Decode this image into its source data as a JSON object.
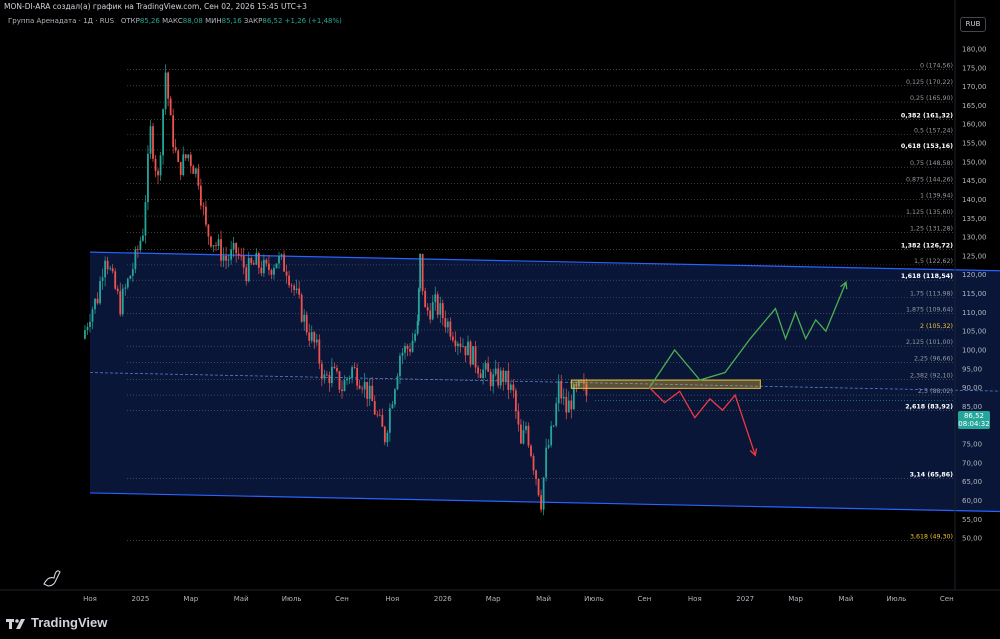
{
  "header": {
    "caption": "MON-DI-ARA создал(а) график на TradingView.com, Сен 02, 2026 15:45 UTC+3"
  },
  "legend": {
    "symbol": "Группа Аренадата · 1Д · RUS",
    "open_label": "ОТКР",
    "open_value": "85,26",
    "high_label": "МАКС",
    "high_value": "88,08",
    "low_label": "МИН",
    "low_value": "85,16",
    "close_label": "ЗАКР",
    "close_value": "86,52",
    "change": "+1,26 (+1,48%)"
  },
  "currency_button": "RUB",
  "price_tag": {
    "price": "86,52",
    "countdown": "08:04:32",
    "color": "#26a69a"
  },
  "branding": {
    "logo_text": "TradingView"
  },
  "colors": {
    "up": "#26a69a",
    "down": "#ef5350",
    "channel": "#2962ff",
    "fib_gold": "#f0c43a",
    "green_path": "#4caf50",
    "red_path": "#f23645",
    "zone": "#f0c43a"
  },
  "chart_data": {
    "type": "candlestick",
    "y_axis": {
      "min": 45,
      "max": 180,
      "ticks": [
        "180,00",
        "175,00",
        "170,00",
        "165,00",
        "160,00",
        "155,00",
        "150,00",
        "145,00",
        "140,00",
        "135,00",
        "130,00",
        "125,00",
        "120,00",
        "115,00",
        "110,00",
        "105,00",
        "100,00",
        "95,00",
        "90,00",
        "85,00",
        "80,00",
        "75,00",
        "70,00",
        "65,00",
        "60,00",
        "55,00",
        "50,00"
      ],
      "tick_values": [
        180,
        175,
        170,
        165,
        160,
        155,
        150,
        145,
        140,
        135,
        130,
        125,
        120,
        115,
        110,
        105,
        100,
        95,
        90,
        85,
        80,
        75,
        70,
        65,
        60,
        55,
        50
      ]
    },
    "x_axis": {
      "labels": [
        "Ноя",
        "2025",
        "Мар",
        "Май",
        "Июль",
        "Сен",
        "Ноя",
        "2026",
        "Мар",
        "Май",
        "Июль",
        "Сен",
        "Ноя",
        "2027",
        "Мар",
        "Май",
        "Июль",
        "Сен"
      ],
      "label_months": [
        0,
        2,
        4,
        6,
        8,
        10,
        12,
        14,
        16,
        18,
        20,
        22,
        24,
        26,
        28,
        30,
        32,
        34
      ]
    },
    "fib_levels": [
      {
        "label": "0 (174,56)",
        "value": 174.56,
        "bold": false,
        "gold": false
      },
      {
        "label": "0,125 (170,22)",
        "value": 170.22,
        "bold": false,
        "gold": false
      },
      {
        "label": "0,25 (165,90)",
        "value": 165.9,
        "bold": false,
        "gold": false
      },
      {
        "label": "0,382 (161,32)",
        "value": 161.32,
        "bold": true,
        "gold": false
      },
      {
        "label": "0,5 (157,24)",
        "value": 157.24,
        "bold": false,
        "gold": false
      },
      {
        "label": "0,618 (153,16)",
        "value": 153.16,
        "bold": true,
        "gold": false
      },
      {
        "label": "0,75 (148,58)",
        "value": 148.58,
        "bold": false,
        "gold": false
      },
      {
        "label": "0,875 (144,26)",
        "value": 144.26,
        "bold": false,
        "gold": false
      },
      {
        "label": "1 (139,94)",
        "value": 139.94,
        "bold": false,
        "gold": false
      },
      {
        "label": "1,125 (135,60)",
        "value": 135.6,
        "bold": false,
        "gold": false
      },
      {
        "label": "1,25 (131,28)",
        "value": 131.28,
        "bold": false,
        "gold": false
      },
      {
        "label": "1,382 (126,72)",
        "value": 126.72,
        "bold": true,
        "gold": false
      },
      {
        "label": "1,5 (122,62)",
        "value": 122.62,
        "bold": false,
        "gold": false
      },
      {
        "label": "1,618 (118,54)",
        "value": 118.54,
        "bold": true,
        "gold": false
      },
      {
        "label": "1,75 (113,98)",
        "value": 113.98,
        "bold": false,
        "gold": false
      },
      {
        "label": "1,875 (109,64)",
        "value": 109.64,
        "bold": false,
        "gold": false
      },
      {
        "label": "2 (105,32)",
        "value": 105.32,
        "bold": false,
        "gold": true
      },
      {
        "label": "2,125 (101,00)",
        "value": 101.0,
        "bold": false,
        "gold": false
      },
      {
        "label": "2,25 (96,66)",
        "value": 96.66,
        "bold": false,
        "gold": false
      },
      {
        "label": "2,382 (92,10)",
        "value": 92.1,
        "bold": false,
        "gold": false
      },
      {
        "label": "2,5 (88,02)",
        "value": 88.02,
        "bold": false,
        "gold": false
      },
      {
        "label": "2,618 (83,92)",
        "value": 83.92,
        "bold": true,
        "gold": false
      },
      {
        "label": "3,14 (65,86)",
        "value": 65.86,
        "bold": true,
        "gold": false
      },
      {
        "label": "3,618 (49,30)",
        "value": 49.3,
        "bold": false,
        "gold": true
      }
    ],
    "price_path": [
      [
        -0.3,
        103
      ],
      [
        0,
        110
      ],
      [
        0.3,
        114
      ],
      [
        0.6,
        126
      ],
      [
        0.9,
        118
      ],
      [
        1.2,
        112
      ],
      [
        1.5,
        118
      ],
      [
        1.8,
        124
      ],
      [
        2.1,
        132
      ],
      [
        2.4,
        158
      ],
      [
        2.7,
        145
      ],
      [
        3.0,
        174
      ],
      [
        3.2,
        160
      ],
      [
        3.5,
        148
      ],
      [
        3.9,
        152
      ],
      [
        4.3,
        146
      ],
      [
        4.6,
        132
      ],
      [
        5.0,
        128
      ],
      [
        5.4,
        124
      ],
      [
        5.8,
        126
      ],
      [
        6.2,
        121
      ],
      [
        6.6,
        123
      ],
      [
        7.0,
        121
      ],
      [
        7.4,
        124
      ],
      [
        7.8,
        122
      ],
      [
        8.2,
        114
      ],
      [
        8.6,
        106
      ],
      [
        9.0,
        100
      ],
      [
        9.3,
        92
      ],
      [
        9.6,
        94
      ],
      [
        10.0,
        90
      ],
      [
        10.4,
        95
      ],
      [
        10.8,
        92
      ],
      [
        11.2,
        86
      ],
      [
        11.5,
        80
      ],
      [
        11.7,
        77
      ],
      [
        12.0,
        88
      ],
      [
        12.3,
        99
      ],
      [
        12.7,
        101
      ],
      [
        13.0,
        106
      ],
      [
        13.1,
        124
      ],
      [
        13.3,
        110
      ],
      [
        13.7,
        112
      ],
      [
        14.1,
        108
      ],
      [
        14.5,
        104
      ],
      [
        15.0,
        100
      ],
      [
        15.5,
        95
      ],
      [
        16.0,
        92
      ],
      [
        16.4,
        93
      ],
      [
        16.8,
        88
      ],
      [
        17.1,
        74
      ],
      [
        17.3,
        80
      ],
      [
        17.6,
        70
      ],
      [
        17.9,
        60
      ],
      [
        18.1,
        72
      ],
      [
        18.4,
        80
      ],
      [
        18.6,
        90
      ],
      [
        18.9,
        84
      ],
      [
        19.2,
        88
      ],
      [
        19.5,
        90
      ],
      [
        19.7,
        88
      ]
    ],
    "channel": {
      "upper": [
        [
          0,
          126
        ],
        [
          36.5,
          121
        ]
      ],
      "lower": [
        [
          0,
          62
        ],
        [
          36.5,
          57
        ]
      ],
      "fill": "rgba(41,98,255,0.22)"
    },
    "midline": [
      [
        0,
        94
      ],
      [
        36.5,
        89
      ]
    ],
    "resistance_zone": {
      "x": [
        19.1,
        26.6
      ],
      "y": [
        89.8,
        92.0
      ]
    },
    "projection_up": [
      [
        22.2,
        90
      ],
      [
        23.2,
        100
      ],
      [
        24.2,
        92
      ],
      [
        25.2,
        94
      ],
      [
        26.2,
        103
      ],
      [
        27.2,
        111
      ],
      [
        27.6,
        103
      ],
      [
        28.0,
        110
      ],
      [
        28.4,
        103
      ],
      [
        28.8,
        108
      ],
      [
        29.2,
        105
      ],
      [
        30.0,
        118
      ]
    ],
    "projection_down": [
      [
        22.2,
        90
      ],
      [
        22.8,
        86
      ],
      [
        23.4,
        89
      ],
      [
        24.0,
        82
      ],
      [
        24.6,
        87
      ],
      [
        25.1,
        84
      ],
      [
        25.6,
        88
      ],
      [
        26.4,
        72
      ]
    ]
  }
}
